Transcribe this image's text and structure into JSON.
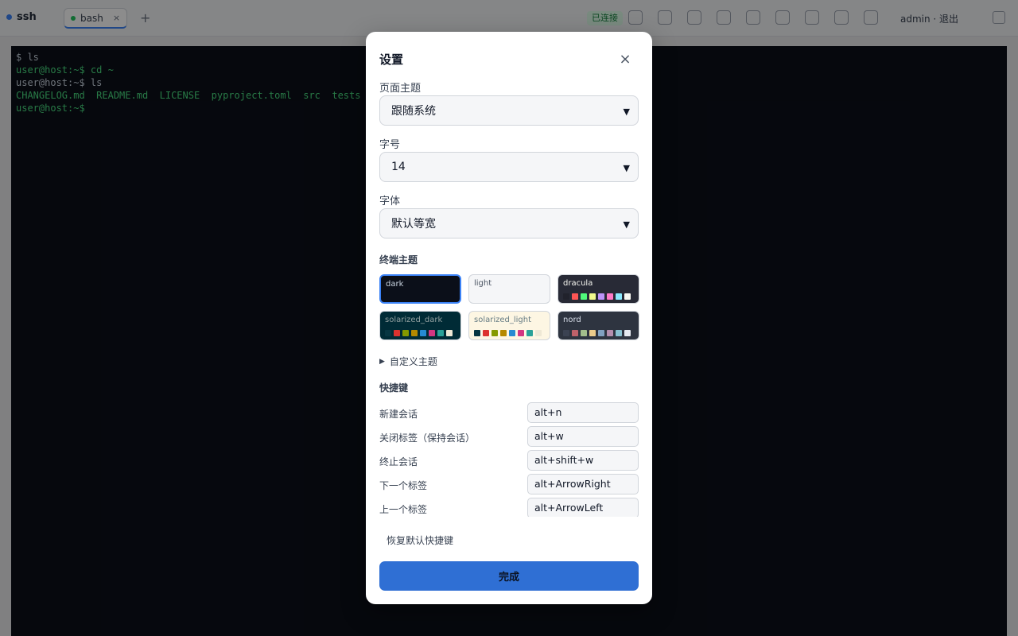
{
  "app": {
    "brand": "ssh",
    "tab_label": "bash",
    "tab_close": "×",
    "add_tab": "+",
    "status_badge": "已连接",
    "user": "admin · 退出",
    "terminal_lines": [
      "$ ls",
      "user@host:~$ cd ~",
      "user@host:~$ ls",
      "CHANGELOG.md  README.md  LICENSE  pyproject.toml  src  tests  docs",
      "user@host:~$"
    ]
  },
  "settings": {
    "title": "设置",
    "close_icon": "×",
    "page_theme_label": "页面主题",
    "page_theme_value": "跟随系统",
    "font_size_label": "字号",
    "font_size_value": "14",
    "font_family_label": "字体",
    "font_family_value": "默认等宽",
    "terminal_theme_title": "终端主题",
    "themes": [
      {
        "name": "dark",
        "bg": "#0b0f19",
        "fg": "#cbd5e1",
        "selected": true,
        "swatches": []
      },
      {
        "name": "light",
        "bg": "#f5f6f8",
        "fg": "#4b5563",
        "selected": false,
        "swatches": []
      },
      {
        "name": "dracula",
        "bg": "#282a36",
        "fg": "#f8f8f2",
        "selected": false,
        "swatches": [
          "#21222c",
          "#ff5555",
          "#50fa7b",
          "#f1fa8c",
          "#bd93f9",
          "#ff79c6",
          "#8be9fd",
          "#f8f8f2"
        ]
      },
      {
        "name": "solarized_dark",
        "bg": "#002b36",
        "fg": "#93a1a1",
        "selected": false,
        "swatches": [
          "#073642",
          "#dc322f",
          "#859900",
          "#b58900",
          "#268bd2",
          "#d33682",
          "#2aa198",
          "#eee8d5"
        ]
      },
      {
        "name": "solarized_light",
        "bg": "#fdf6e3",
        "fg": "#657b83",
        "selected": false,
        "swatches": [
          "#073642",
          "#dc322f",
          "#859900",
          "#b58900",
          "#268bd2",
          "#d33682",
          "#2aa198",
          "#eee8d5"
        ]
      },
      {
        "name": "nord",
        "bg": "#2e3440",
        "fg": "#d8dee9",
        "selected": false,
        "swatches": [
          "#3b4252",
          "#bf616a",
          "#a3be8c",
          "#ebcb8b",
          "#81a1c1",
          "#b48ead",
          "#88c0d0",
          "#e5e9f0"
        ]
      }
    ],
    "custom_theme_label": "自定义主题",
    "shortcuts_title": "快捷键",
    "shortcuts": [
      {
        "label": "新建会话",
        "value": "alt+n"
      },
      {
        "label": "关闭标签（保持会话）",
        "value": "alt+w"
      },
      {
        "label": "终止会话",
        "value": "alt+shift+w"
      },
      {
        "label": "下一个标签",
        "value": "alt+ArrowRight"
      },
      {
        "label": "上一个标签",
        "value": "alt+ArrowLeft"
      }
    ],
    "reset_shortcuts_label": "恢复默认快捷键",
    "done_label": "完成"
  },
  "colors": {
    "accent": "#2f6fd4",
    "selected_border": "#3b82f6"
  }
}
